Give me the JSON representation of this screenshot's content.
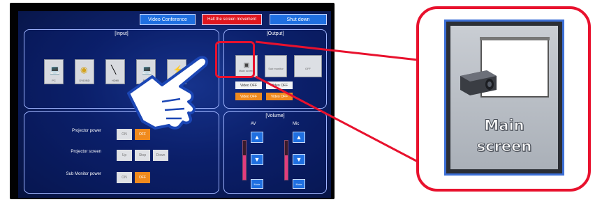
{
  "panel": {
    "top_buttons": {
      "video_conference": "Video Conference",
      "halt_screen": "Halt the screen movement",
      "shut_down": "Shut down"
    },
    "input": {
      "title": "[Input]",
      "sources": [
        {
          "label": "PC",
          "icon": "laptop-icon"
        },
        {
          "label": "DVD/BD",
          "icon": "disc-icon"
        },
        {
          "label": "HDMI",
          "icon": "hdmi-cable-icon"
        },
        {
          "label": "RGB",
          "icon": "laptop-icon"
        },
        {
          "label": "",
          "icon": "av-cable-icon"
        }
      ]
    },
    "output": {
      "title": "[Output]",
      "main_screen": "Main screen",
      "sub_monitor": "Sub monitor",
      "off": "OFF",
      "video_off_1": "Video OFF",
      "video_off_2": "Video OFF",
      "video_off_3": "Video OFF",
      "video_off_4": "Video OFF"
    },
    "controls": {
      "projector_power": "Projector power",
      "projector_screen": "Projector screen",
      "sub_monitor_power": "Sub Monitor power",
      "on": "ON",
      "off": "OFF",
      "up": "Up",
      "stop": "Stop",
      "down": "Down"
    },
    "volume": {
      "title": "[Volume]",
      "av": "AV",
      "mic": "Mic",
      "mute": "Mute",
      "av_level": 0.62,
      "mic_level": 0.62
    }
  },
  "callout": {
    "line1": "Main",
    "line2": "screen",
    "icon": "projector-screen-icon"
  },
  "colors": {
    "highlight_red": "#e8112d",
    "panel_blue": "#0d2169",
    "button_blue": "#1f6fe0",
    "button_orange": "#f08a1e",
    "halt_red": "#e0161e"
  }
}
